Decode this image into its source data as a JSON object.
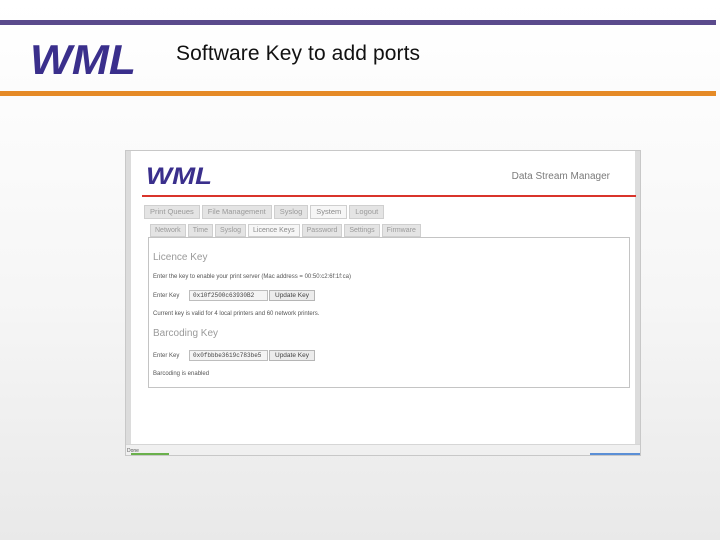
{
  "slide": {
    "title": "Software Key to add ports",
    "logo_text": "WML",
    "colors": {
      "top_bar": "#5a4a8c",
      "accent_bar": "#e58a26",
      "logo": "#3a2f8c"
    }
  },
  "app": {
    "logo_text": "WML",
    "name": "Data Stream Manager",
    "colors": {
      "header_line": "#d9342b"
    },
    "main_tabs": [
      {
        "label": "Print Queues"
      },
      {
        "label": "File Management"
      },
      {
        "label": "Syslog"
      },
      {
        "label": "System",
        "active": true
      },
      {
        "label": "Logout"
      }
    ],
    "sub_tabs": [
      {
        "label": "Network"
      },
      {
        "label": "Time"
      },
      {
        "label": "Syslog"
      },
      {
        "label": "Licence Keys",
        "active": true
      },
      {
        "label": "Password"
      },
      {
        "label": "Settings"
      },
      {
        "label": "Firmware"
      }
    ],
    "licence": {
      "heading": "Licence Key",
      "instructions": "Enter the key to enable your print server (Mac address = 00:50:c2:6f:1f:ca)",
      "enter_label": "Enter Key",
      "key_value": "0x10f2500c63930B2",
      "update_button": "Update Key",
      "status": "Current key is valid for 4 local printers and 60 network printers."
    },
    "barcoding": {
      "heading": "Barcoding Key",
      "enter_label": "Enter Key",
      "key_value": "0x0fbbbe3619c783be5",
      "update_button": "Update Key",
      "status": "Barcoding is enabled"
    },
    "status_bar": {
      "text": "Done"
    }
  }
}
